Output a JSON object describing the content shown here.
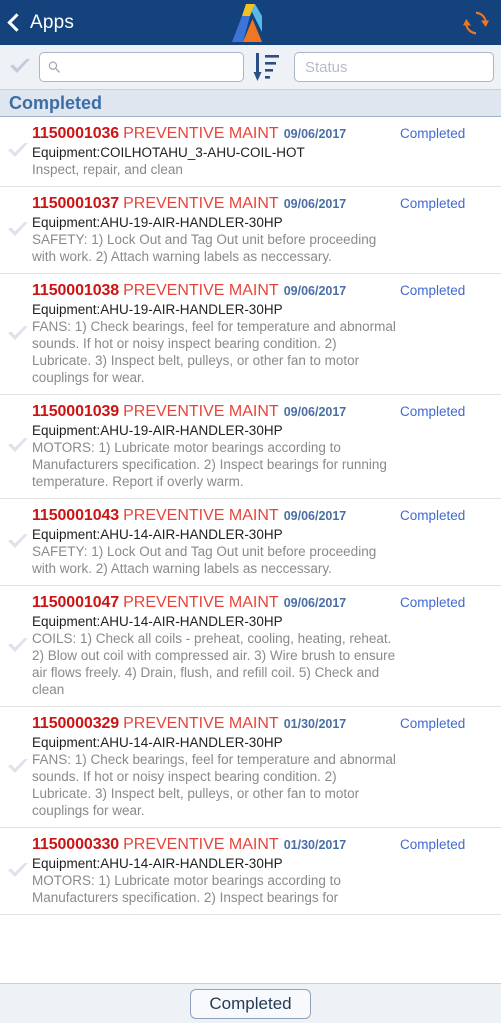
{
  "header": {
    "back_label": "Apps",
    "back_icon": "chevron-left-icon",
    "logo_icon": "accruent-a-logo",
    "refresh_icon": "refresh-sync-icon",
    "background_color": "#13427c"
  },
  "toolbar": {
    "check_icon": "checkmark-icon",
    "search_icon": "search-icon",
    "search_value": "",
    "search_placeholder": "",
    "sort_icon": "sort-descending-icon",
    "status_value": "",
    "status_placeholder": "Status"
  },
  "section": {
    "title": "Completed"
  },
  "list": {
    "items": [
      {
        "check_icon": "checkmark-icon",
        "id": "1150001036",
        "type": "PREVENTIVE MAINT",
        "date": "09/06/2017",
        "equipment": "Equipment:COILHOTAHU_3-AHU-COIL-HOT",
        "description": "Inspect, repair, and clean",
        "status": "Completed"
      },
      {
        "check_icon": "checkmark-icon",
        "id": "1150001037",
        "type": "PREVENTIVE MAINT",
        "date": "09/06/2017",
        "equipment": "Equipment:AHU-19-AIR-HANDLER-30HP",
        "description": "SAFETY: 1) Lock Out and Tag Out unit before proceeding with work. 2) Attach warning labels as neccessary.",
        "status": "Completed"
      },
      {
        "check_icon": "checkmark-icon",
        "id": "1150001038",
        "type": "PREVENTIVE MAINT",
        "date": "09/06/2017",
        "equipment": "Equipment:AHU-19-AIR-HANDLER-30HP",
        "description": "FANS: 1) Check bearings, feel for temperature and abnormal sounds. If hot or noisy inspect bearing condition. 2) Lubricate. 3) Inspect belt, pulleys, or other fan to motor couplings for wear.",
        "status": "Completed"
      },
      {
        "check_icon": "checkmark-icon",
        "id": "1150001039",
        "type": "PREVENTIVE MAINT",
        "date": "09/06/2017",
        "equipment": "Equipment:AHU-19-AIR-HANDLER-30HP",
        "description": "MOTORS: 1) Lubricate motor bearings according to Manufacturers specification. 2) Inspect bearings for running temperature. Report if overly warm.",
        "status": "Completed"
      },
      {
        "check_icon": "checkmark-icon",
        "id": "1150001043",
        "type": "PREVENTIVE MAINT",
        "date": "09/06/2017",
        "equipment": "Equipment:AHU-14-AIR-HANDLER-30HP",
        "description": "SAFETY: 1) Lock Out and Tag Out unit before proceeding with work. 2) Attach warning labels as neccessary.",
        "status": "Completed"
      },
      {
        "check_icon": "checkmark-icon",
        "id": "1150001047",
        "type": "PREVENTIVE MAINT",
        "date": "09/06/2017",
        "equipment": "Equipment:AHU-14-AIR-HANDLER-30HP",
        "description": "COILS: 1) Check all coils - preheat, cooling, heating, reheat. 2) Blow out coil with compressed air. 3) Wire brush to ensure air flows freely. 4) Drain, flush, and refill coil. 5) Check and clean",
        "status": "Completed"
      },
      {
        "check_icon": "checkmark-icon",
        "id": "1150000329",
        "type": "PREVENTIVE MAINT",
        "date": "01/30/2017",
        "equipment": "Equipment:AHU-14-AIR-HANDLER-30HP",
        "description": "FANS: 1) Check bearings, feel for temperature and abnormal sounds. If hot or noisy inspect bearing condition. 2) Lubricate. 3) Inspect belt, pulleys, or other fan to motor couplings for wear.",
        "status": "Completed"
      },
      {
        "check_icon": "checkmark-icon",
        "id": "1150000330",
        "type": "PREVENTIVE MAINT",
        "date": "01/30/2017",
        "equipment": "Equipment:AHU-14-AIR-HANDLER-30HP",
        "description": "MOTORS: 1) Lubricate motor bearings according to Manufacturers specification. 2) Inspect bearings for",
        "status": "Completed"
      }
    ]
  },
  "footer": {
    "button_label": "Completed"
  },
  "colors": {
    "header_blue": "#13427c",
    "accent_orange": "#ef7622",
    "wo_id_red": "#cc1414",
    "wo_type_red": "#e8443a",
    "date_blue": "#4a6fa5",
    "status_blue": "#4169d1",
    "section_bg": "#dfe6f0",
    "section_text": "#3b6ea5"
  }
}
